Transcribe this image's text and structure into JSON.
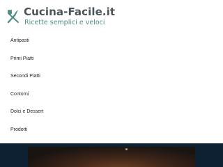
{
  "header": {
    "title": "Cucina-Facile.it",
    "tagline": "Ricette semplici e veloci",
    "logo_icon": "fork-knife-icon",
    "accent_color": "#4e8f86",
    "title_color": "#4a5358"
  },
  "nav": {
    "items": [
      {
        "label": "Antipasti"
      },
      {
        "label": "Primi Piatti"
      },
      {
        "label": "Secondi Piatti"
      },
      {
        "label": "Contorni"
      },
      {
        "label": "Dolci e Dessert"
      },
      {
        "label": "Prodotti"
      }
    ]
  },
  "hero": {
    "background_color": "#0d2133",
    "image": "food-photo"
  }
}
